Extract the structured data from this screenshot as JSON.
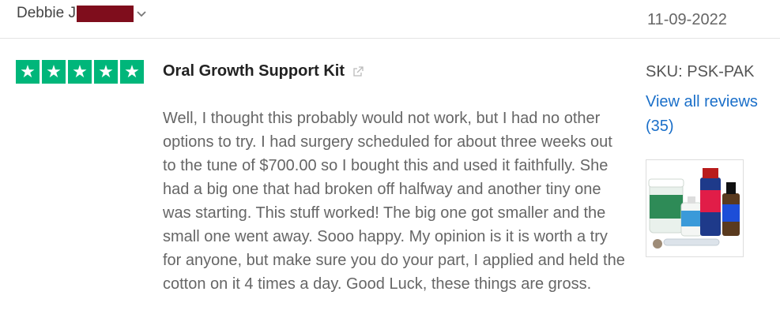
{
  "review": {
    "reviewer_name": "Debbie J",
    "date": "11-09-2022",
    "rating": 5,
    "star_glyph": "★",
    "star_color": "#00b67a",
    "title": "Oral Growth Support Kit",
    "body": "Well, I thought this probably would not work, but I had no other options to try. I had surgery scheduled for about three weeks out to the tune of $700.00 so I bought this and used it faithfully. She had a big one that had broken off halfway and another tiny one was starting. This stuff worked! The big one got smaller and the small one went away. Sooo happy. My opinion is it is worth a try for anyone, but make sure you do your part, I applied and held the cotton on it 4 times a day. Good Luck, these things are gross."
  },
  "sidebar": {
    "sku": "SKU: PSK-PAK",
    "view_all_label": "View all reviews (35)"
  },
  "icons": {
    "dropdown": "chevron-down-icon",
    "external_link": "external-link-icon",
    "redaction_color": "#7f0d1c",
    "link_color": "#1a6fc9"
  }
}
